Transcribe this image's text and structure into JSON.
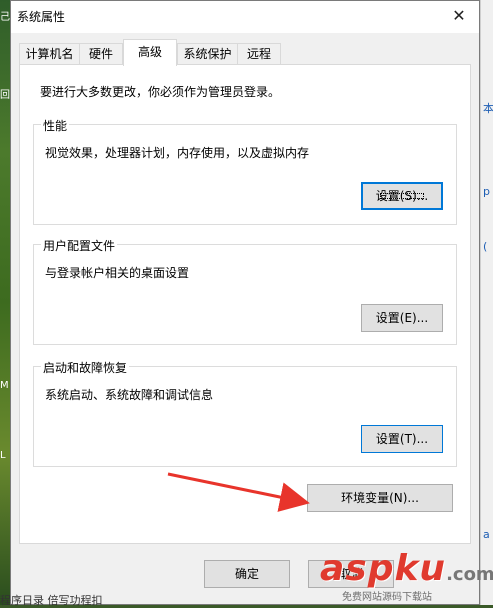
{
  "desktop": {
    "glyphs": [
      "己",
      "回",
      "M",
      "L"
    ]
  },
  "backdrop": {
    "glyphs": [
      "本",
      "p",
      "(",
      "a"
    ]
  },
  "window": {
    "title": "系统属性",
    "close_glyph": "✕"
  },
  "tabs": [
    {
      "label": "计算机名",
      "active": false
    },
    {
      "label": "硬件",
      "active": false
    },
    {
      "label": "高级",
      "active": true
    },
    {
      "label": "系统保护",
      "active": false
    },
    {
      "label": "远程",
      "active": false
    }
  ],
  "notice": "要进行大多数更改，你必须作为管理员登录。",
  "groups": {
    "performance": {
      "label": "性能",
      "desc": "视觉效果，处理器计划，内存使用，以及虚拟内存",
      "button": "设置(S)..."
    },
    "profiles": {
      "label": "用户配置文件",
      "desc": "与登录帐户相关的桌面设置",
      "button": "设置(E)..."
    },
    "startup": {
      "label": "启动和故障恢复",
      "desc": "系统启动、系统故障和调试信息",
      "button": "设置(T)..."
    }
  },
  "env_button": "环境变量(N)...",
  "footer": {
    "ok": "确定",
    "cancel": "取消"
  },
  "watermark": {
    "main": "aspku",
    "tld": ".com",
    "sub": "免费网站源码下载站"
  },
  "taskbar": "程序日录    倍写功程扣",
  "accent_color": "#0078d7",
  "arrow_color": "#e8342b"
}
